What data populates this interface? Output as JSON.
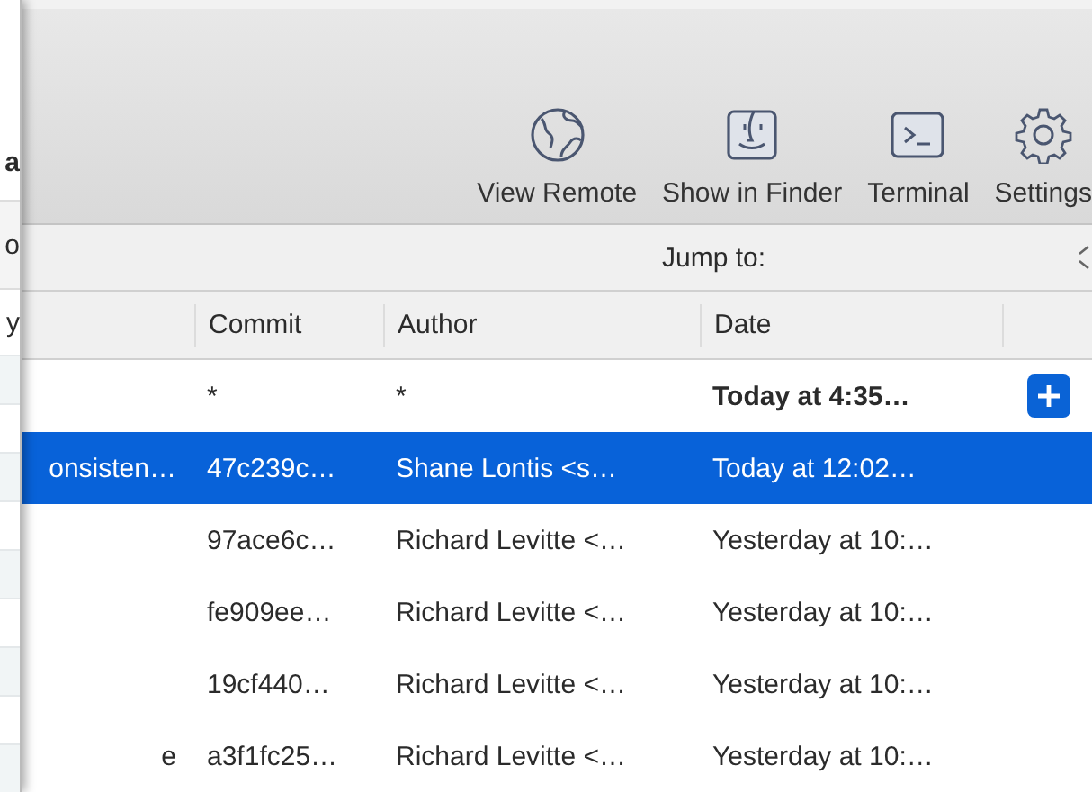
{
  "left_window": {
    "items": [
      {
        "kind": "title",
        "text": "a"
      },
      {
        "kind": "header",
        "text": "o"
      },
      {
        "kind": "cell",
        "text": "y"
      }
    ]
  },
  "toolbar": {
    "buttons": [
      {
        "kind": "globe",
        "label": "View Remote"
      },
      {
        "kind": "finder",
        "label": "Show in Finder"
      },
      {
        "kind": "terminal",
        "label": "Terminal"
      },
      {
        "kind": "gear",
        "label": "Settings"
      }
    ]
  },
  "jump_bar": {
    "label": "Jump to:"
  },
  "table": {
    "columns": [
      "Commit",
      "Author",
      "Date"
    ],
    "rows": [
      {
        "kind": "working-copy",
        "selected": false,
        "commit": "*",
        "author": "*",
        "date": "Today at 4:35…"
      },
      {
        "kind": "commit",
        "selected": true,
        "column_1": "onsisten…",
        "commit": "47c239c…",
        "author": "Shane Lontis <s…",
        "date": "Today at 12:02…"
      },
      {
        "kind": "commit",
        "selected": false,
        "commit": "97ace6c…",
        "author": "Richard Levitte <…",
        "date": "Yesterday at 10:…"
      },
      {
        "kind": "commit",
        "selected": false,
        "commit": "fe909ee…",
        "author": "Richard Levitte <…",
        "date": "Yesterday at 10:…"
      },
      {
        "kind": "commit",
        "selected": false,
        "commit": "19cf440…",
        "author": "Richard Levitte <…",
        "date": "Yesterday at 10:…"
      },
      {
        "kind": "commit",
        "selected": false,
        "column_1": "e",
        "commit": "a3f1fc25…",
        "author": "Richard Levitte <…",
        "date": "Yesterday at 10:…"
      }
    ]
  }
}
